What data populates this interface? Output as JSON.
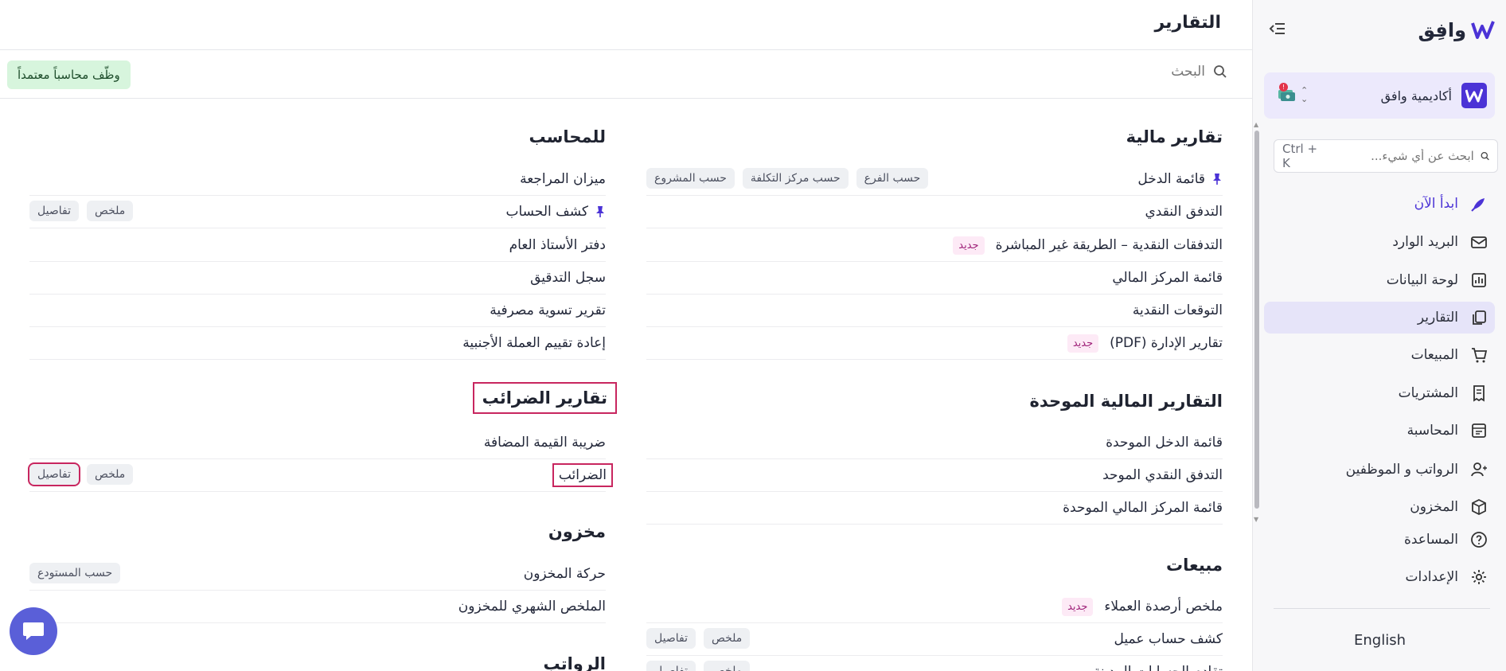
{
  "app": {
    "logo_text": "وافِق"
  },
  "sidebar": {
    "org_name": "أكاديمية وافق",
    "notification_count": "!",
    "search_placeholder": "ابحث عن أي شيء...",
    "search_shortcut": "Ctrl + K",
    "items": [
      {
        "label": "ابدأ الآن",
        "icon": "rocket-icon"
      },
      {
        "label": "البريد الوارد",
        "icon": "inbox-icon"
      },
      {
        "label": "لوحة البيانات",
        "icon": "dashboard-icon"
      },
      {
        "label": "التقارير",
        "icon": "reports-icon"
      },
      {
        "label": "المبيعات",
        "icon": "cart-icon"
      },
      {
        "label": "المشتريات",
        "icon": "receipt-icon"
      },
      {
        "label": "المحاسبة",
        "icon": "ledger-icon"
      },
      {
        "label": "الرواتب و الموظفين",
        "icon": "users-icon"
      },
      {
        "label": "المخزون",
        "icon": "box-icon"
      },
      {
        "label": "المساعدة",
        "icon": "help-icon"
      },
      {
        "label": "الإعدادات",
        "icon": "gear-icon"
      }
    ],
    "language": "English"
  },
  "header": {
    "title": "التقارير"
  },
  "toolbar": {
    "search_placeholder": "البحث",
    "hire_accountant": "وظّف محاسباً معتمداً"
  },
  "sections": {
    "financial": {
      "title": "تقارير مالية",
      "rows": [
        {
          "label": "قائمة الدخل",
          "chips": [
            "حسب المشروع",
            "حسب مركز التكلفة",
            "حسب الفرع"
          ]
        },
        {
          "label": "التدفق النقدي"
        },
        {
          "label": "التدفقات النقدية – الطريقة غير المباشرة",
          "tag": "جديد"
        },
        {
          "label": "قائمة المركز المالي"
        },
        {
          "label": "التوقعات النقدية"
        },
        {
          "label": "تقارير الإدارة (PDF)",
          "tag": "جديد"
        }
      ]
    },
    "consolidated": {
      "title": "التقارير المالية الموحدة",
      "rows": [
        {
          "label": "قائمة الدخل الموحدة"
        },
        {
          "label": "التدفق النقدي الموحد"
        },
        {
          "label": "قائمة المركز المالي الموحدة"
        }
      ]
    },
    "sales": {
      "title": "مبيعات",
      "rows": [
        {
          "label": "ملخص أرصدة العملاء",
          "tag": "جديد"
        },
        {
          "label": "كشف حساب عميل",
          "chips": [
            "تفاصيل",
            "ملخص"
          ]
        },
        {
          "label": "تقادم الحسابات المدينة",
          "chips": [
            "تفاصيل",
            "ملخص"
          ]
        }
      ]
    },
    "accountant": {
      "title": "للمحاسب",
      "rows": [
        {
          "label": "ميزان المراجعة"
        },
        {
          "label": "كشف الحساب",
          "chips": [
            "تفاصيل",
            "ملخص"
          ]
        },
        {
          "label": "دفتر الأستاذ العام"
        },
        {
          "label": "سجل التدقيق"
        },
        {
          "label": "تقرير تسوية مصرفية"
        },
        {
          "label": "إعادة تقييم العملة الأجنبية"
        }
      ]
    },
    "tax": {
      "title": "تقارير الضرائب",
      "rows": [
        {
          "label": "ضريبة القيمة المضافة"
        },
        {
          "label": "الضرائب",
          "chips": [
            "تفاصيل",
            "ملخص"
          ]
        }
      ]
    },
    "inventory": {
      "title": "مخزون",
      "rows": [
        {
          "label": "حركة المخزون",
          "chips": [
            "حسب المستودع"
          ]
        },
        {
          "label": "الملخص الشهري للمخزون"
        }
      ]
    },
    "payroll": {
      "title": "الرواتب"
    }
  },
  "colors": {
    "brand": "#4b33d6",
    "tag_new_bg": "#fdeaf6",
    "highlight_outline": "#c8265f",
    "hire_badge_bg": "#d7f5dd"
  }
}
